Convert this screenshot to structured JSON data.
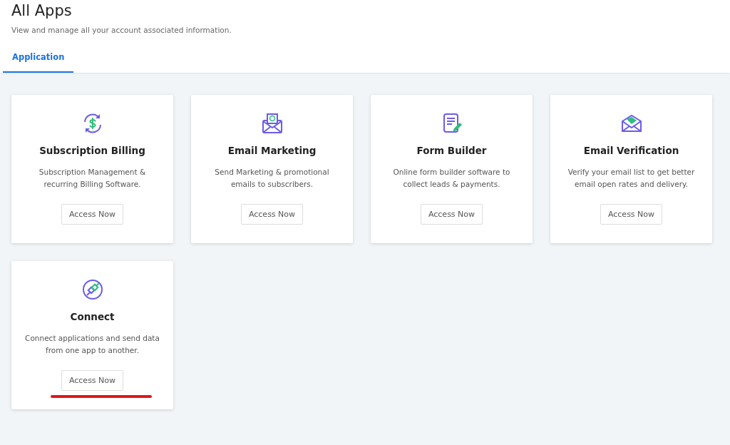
{
  "header": {
    "title": "All Apps",
    "subtitle": "View and manage all your account associated information."
  },
  "tabs": [
    {
      "label": "Application",
      "selected": true
    }
  ],
  "apps": [
    {
      "kind": "billing",
      "name": "Subscription Billing",
      "description": "Subscription Management & recurring Billing Software.",
      "button": "Access Now",
      "underlined": false
    },
    {
      "kind": "email",
      "name": "Email Marketing",
      "description": "Send Marketing & promotional emails to subscribers.",
      "button": "Access Now",
      "underlined": false
    },
    {
      "kind": "form",
      "name": "Form Builder",
      "description": "Online form builder software to collect leads & payments.",
      "button": "Access Now",
      "underlined": false
    },
    {
      "kind": "verify",
      "name": "Email Verification",
      "description": "Verify your email list to get better email open rates and delivery.",
      "button": "Access Now",
      "underlined": false
    },
    {
      "kind": "connect",
      "name": "Connect",
      "description": "Connect applications and send data from one app to another.",
      "button": "Access Now",
      "underlined": true
    }
  ]
}
